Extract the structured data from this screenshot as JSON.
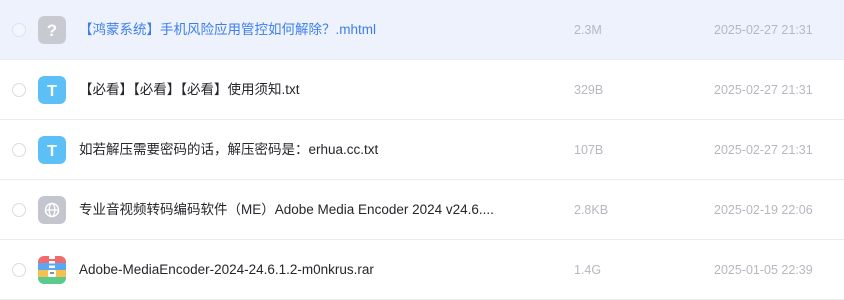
{
  "files": [
    {
      "name": "【鸿蒙系统】手机风险应用管控如何解除？.mhtml",
      "size": "2.3M",
      "date": "2025-02-27 21:31",
      "icon": "unknown-file-icon",
      "selected": true
    },
    {
      "name": "【必看】【必看】【必看】使用须知.txt",
      "size": "329B",
      "date": "2025-02-27 21:31",
      "icon": "text-file-icon",
      "icon_letter": "T",
      "selected": false
    },
    {
      "name": "如若解压需要密码的话，解压密码是：erhua.cc.txt",
      "size": "107B",
      "date": "2025-02-27 21:31",
      "icon": "text-file-icon",
      "icon_letter": "T",
      "selected": false
    },
    {
      "name": "专业音视频转码编码软件（ME）Adobe Media Encoder 2024 v24.6....",
      "size": "2.8KB",
      "date": "2025-02-19 22:06",
      "icon": "web-link-icon",
      "selected": false
    },
    {
      "name": "Adobe-MediaEncoder-2024-24.6.1.2-m0nkrus.rar",
      "size": "1.4G",
      "date": "2025-01-05 22:39",
      "icon": "archive-file-icon",
      "selected": false
    }
  ],
  "colors": {
    "selected_row_bg": "#eef2fd",
    "selected_text": "#3d7eea",
    "text_icon": "#5cc0f7",
    "unknown_icon": "#c8cad2",
    "link_icon": "#c3c6cf",
    "meta_text": "#b6b8bf"
  }
}
